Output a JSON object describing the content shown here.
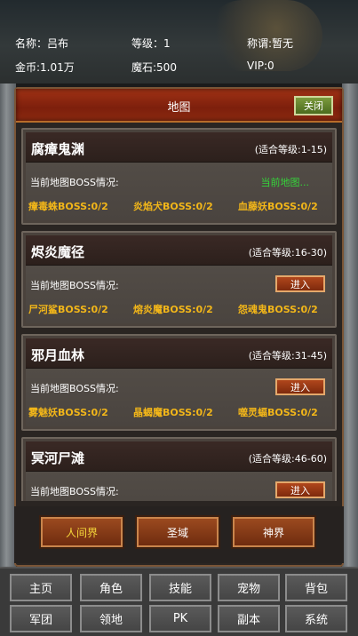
{
  "header": {
    "name_label": "名称：吕布",
    "level_label": "等级：1",
    "title_label": "称谓:暂无",
    "gold_label": "金币:1.01万",
    "magic_stone_label": "魔石:500",
    "vip_label": "VIP:0"
  },
  "panel": {
    "title": "地图",
    "close_label": "关闭"
  },
  "maps": [
    {
      "name": "腐瘴鬼渊",
      "level_range": "(适合等级:1-15)",
      "boss_label": "当前地图BOSS情况:",
      "status": "当前地图...",
      "bosses": [
        "瘴毒蛛BOSS:0/2",
        "炎焰犬BOSS:0/2",
        "血藤妖BOSS:0/2"
      ]
    },
    {
      "name": "烬炎魔径",
      "level_range": "(适合等级:16-30)",
      "boss_label": "当前地图BOSS情况:",
      "enter_label": "进入",
      "bosses": [
        "尸河鲨BOSS:0/2",
        "熔炎魔BOSS:0/2",
        "怨魂鬼BOSS:0/2"
      ]
    },
    {
      "name": "邪月血林",
      "level_range": "(适合等级:31-45)",
      "boss_label": "当前地图BOSS情况:",
      "enter_label": "进入",
      "bosses": [
        "雾魅妖BOSS:0/2",
        "晶蝎魔BOSS:0/2",
        "噬灵蝠BOSS:0/2"
      ]
    },
    {
      "name": "冥河尸滩",
      "level_range": "(适合等级:46-60)",
      "boss_label": "当前地图BOSS情况:",
      "enter_label": "进入"
    }
  ],
  "realms": [
    {
      "label": "人间界",
      "active": true
    },
    {
      "label": "圣域",
      "active": false
    },
    {
      "label": "神界",
      "active": false
    }
  ],
  "nav": {
    "row1": [
      "主页",
      "角色",
      "技能",
      "宠物",
      "背包"
    ],
    "row2": [
      "军团",
      "领地",
      "PK",
      "副本",
      "系统"
    ]
  },
  "colors": {
    "boss_text": "#f2b619",
    "current_map_text": "#35d43a",
    "title_bar": "#8c2a10",
    "active_realm_text": "#f5d63a"
  }
}
